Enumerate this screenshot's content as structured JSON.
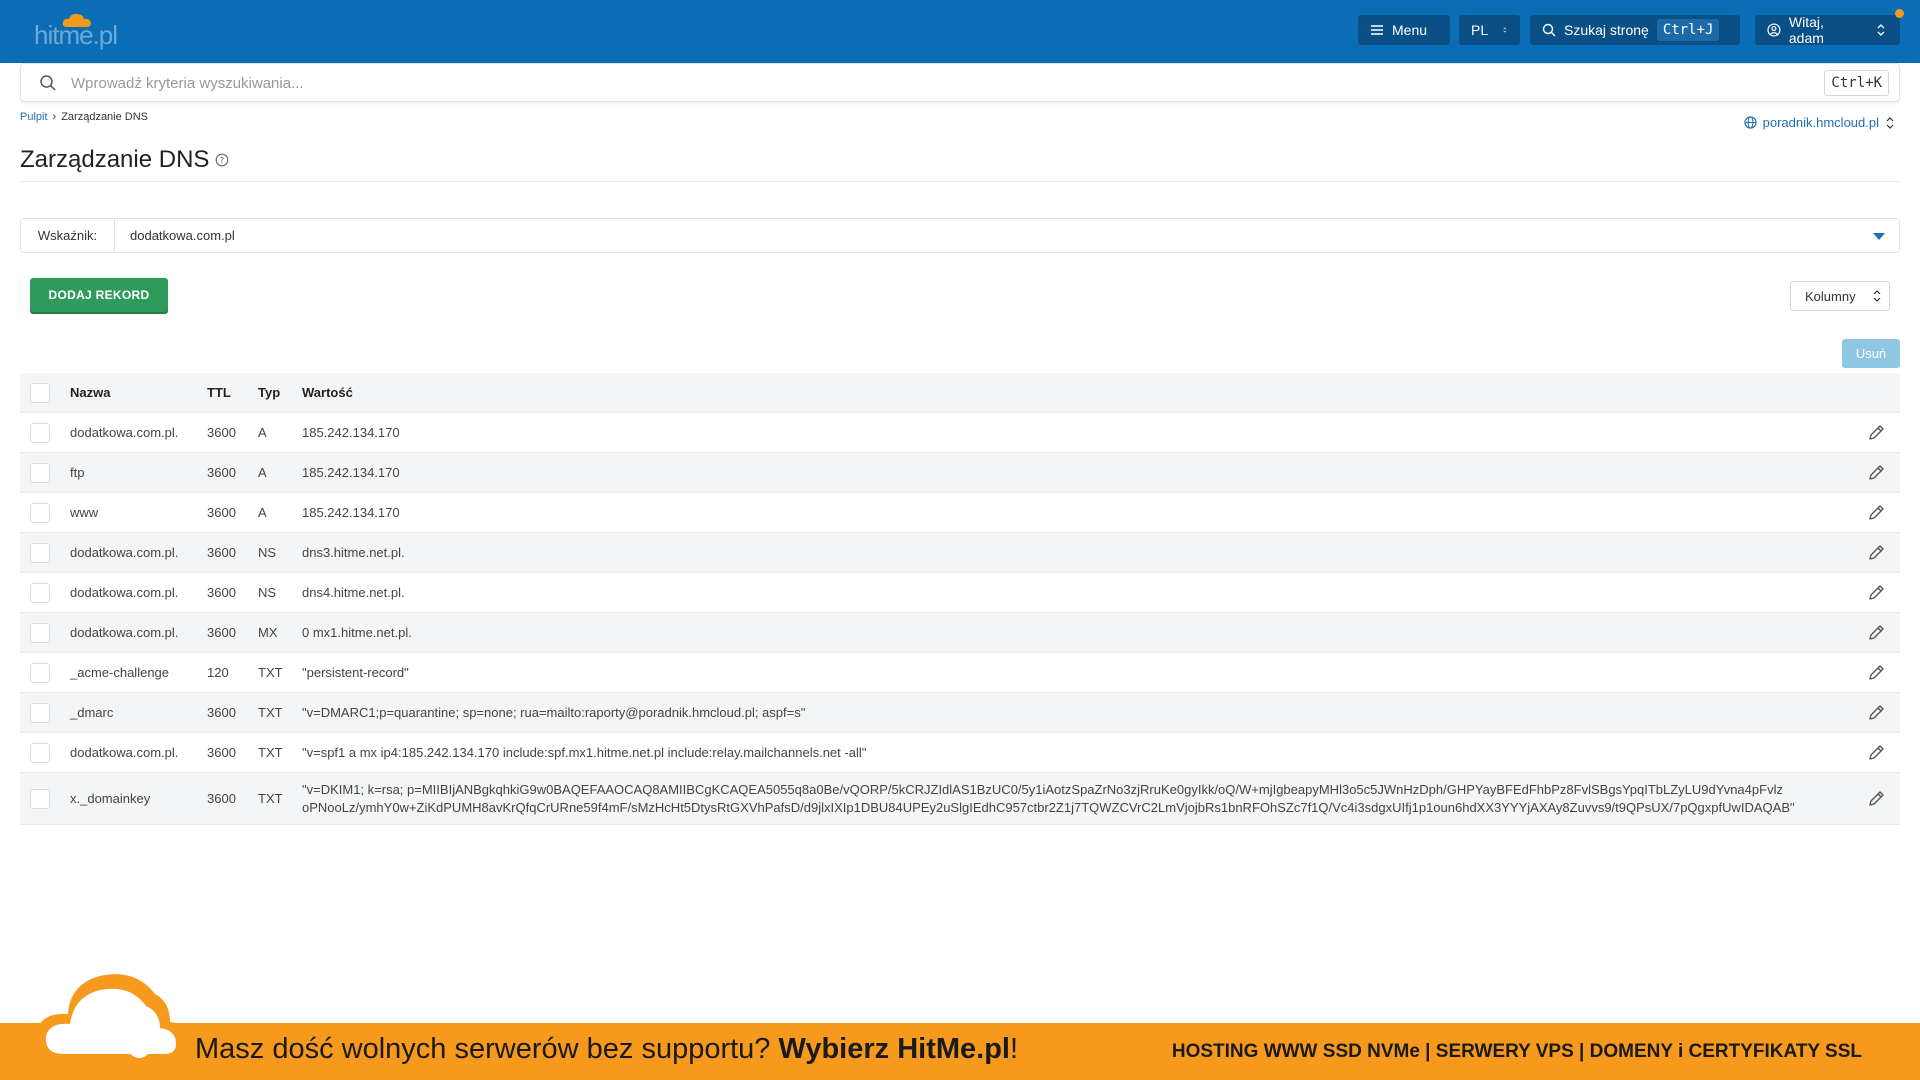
{
  "header": {
    "logo_text": "hitme.pl",
    "menu_label": "Menu",
    "lang_label": "PL",
    "search_page_label": "Szukaj stronę",
    "search_page_shortcut": "Ctrl+J",
    "user_label": "Witaj, adam",
    "colors": {
      "bar": "#0b6db5",
      "button": "#0a4f86",
      "notify": "#f29a1b"
    }
  },
  "search": {
    "placeholder": "Wprowadź kryteria wyszukiwania...",
    "shortcut": "Ctrl+K"
  },
  "breadcrumb": {
    "root": "Pulpit",
    "current": "Zarządzanie DNS"
  },
  "domain_selector": "poradnik.hmcloud.pl",
  "page": {
    "title": "Zarządzanie DNS"
  },
  "indicator": {
    "label": "Wskaźnik:",
    "value": "dodatkowa.com.pl"
  },
  "actions": {
    "add_record": "DODAJ REKORD",
    "columns": "Kolumny",
    "delete": "Usuń"
  },
  "table": {
    "columns": [
      "Nazwa",
      "TTL",
      "Typ",
      "Wartość"
    ],
    "rows": [
      {
        "name": "dodatkowa.com.pl.",
        "ttl": "3600",
        "type": "A",
        "value": "185.242.134.170"
      },
      {
        "name": "ftp",
        "ttl": "3600",
        "type": "A",
        "value": "185.242.134.170"
      },
      {
        "name": "www",
        "ttl": "3600",
        "type": "A",
        "value": "185.242.134.170"
      },
      {
        "name": "dodatkowa.com.pl.",
        "ttl": "3600",
        "type": "NS",
        "value": "dns3.hitme.net.pl."
      },
      {
        "name": "dodatkowa.com.pl.",
        "ttl": "3600",
        "type": "NS",
        "value": "dns4.hitme.net.pl."
      },
      {
        "name": "dodatkowa.com.pl.",
        "ttl": "3600",
        "type": "MX",
        "value": "0 mx1.hitme.net.pl."
      },
      {
        "name": "_acme-challenge",
        "ttl": "120",
        "type": "TXT",
        "value": "\"persistent-record\""
      },
      {
        "name": "_dmarc",
        "ttl": "3600",
        "type": "TXT",
        "value": "\"v=DMARC1;p=quarantine; sp=none; rua=mailto:raporty@poradnik.hmcloud.pl; aspf=s\""
      },
      {
        "name": "dodatkowa.com.pl.",
        "ttl": "3600",
        "type": "TXT",
        "value": "\"v=spf1 a mx ip4:185.242.134.170 include:spf.mx1.hitme.net.pl include:relay.mailchannels.net -all\""
      },
      {
        "name": "x._domainkey",
        "ttl": "3600",
        "type": "TXT",
        "value": "\"v=DKIM1; k=rsa; p=MIIBIjANBgkqhkiG9w0BAQEFAAOCAQ8AMIIBCgKCAQEA5055q8a0Be/vQORP/5kCRJZIdlAS1BzUC0/5y1iAotzSpaZrNo3zjRruKe0gyIkk/oQ/W+mjIgbeapyMHl3o5c5JWnHzDph/GHPYayBFEdFhbPz8FvlSBgsYpqITbLZyLU9dYvna4pFvlz oPNooLz/ymhY0w+ZiKdPUMH8avKrQfqCrURne59f4mF/sMzHcHt5DtysRtGXVhPafsD/d9jlxIXIp1DBU84UPEy2uSlgIEdhC957ctbr2Z1j7TQWZCVrC2LmVjojbRs1bnRFOhSZc7f1Q/Vc4i3sdgxUIfj1p1oun6hdXX3YYYjAXAy8Zuvvs9/t9QPsUX/7pQgxpfUwIDAQAB\""
      }
    ]
  },
  "banner": {
    "text_regular": "Masz dość wolnych serwerów bez supportu? ",
    "text_bold": "Wybierz HitMe.pl",
    "text_end": "!",
    "right_text": "HOSTING WWW SSD NVMe | SERWERY VPS | DOMENY i CERTYFIKATY SSL",
    "color": "#f6991d"
  }
}
